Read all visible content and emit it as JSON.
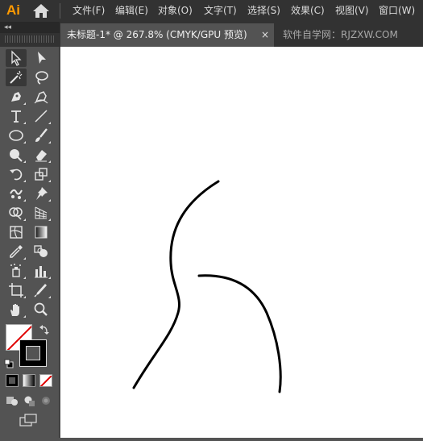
{
  "app": {
    "logo_text": "Ai",
    "menu": [
      "文件(F)",
      "编辑(E)",
      "对象(O)",
      "文字(T)",
      "选择(S)",
      "效果(C)",
      "视图(V)",
      "窗口(W)"
    ]
  },
  "tabs": {
    "active_label": "未标题-1* @ 267.8% (CMYK/GPU 预览)",
    "close_glyph": "×",
    "inactive_label": "软件自学网：RJZXW.COM"
  },
  "toolbar": {
    "collapse_glyph": "◂◂",
    "tools": [
      "selection-tool",
      "direct-selection-tool",
      "magic-wand-tool",
      "lasso-tool",
      "pen-tool",
      "curvature-tool",
      "type-tool",
      "line-segment-tool",
      "ellipse-tool",
      "paintbrush-tool",
      "shaper-tool",
      "eraser-tool",
      "rotate-tool",
      "scale-tool",
      "puppet-warp-tool",
      "pin-tool",
      "shape-builder-tool",
      "perspective-grid-tool",
      "mesh-tool",
      "gradient-tool",
      "eyedropper-tool",
      "blend-tool",
      "symbol-sprayer-tool",
      "column-graph-tool",
      "artboard-tool",
      "slice-tool",
      "hand-tool",
      "zoom-tool"
    ],
    "fill_color": "none",
    "stroke_color": "#000000"
  },
  "canvas": {
    "background": "#ffffff",
    "stroke_color": "#000000"
  }
}
